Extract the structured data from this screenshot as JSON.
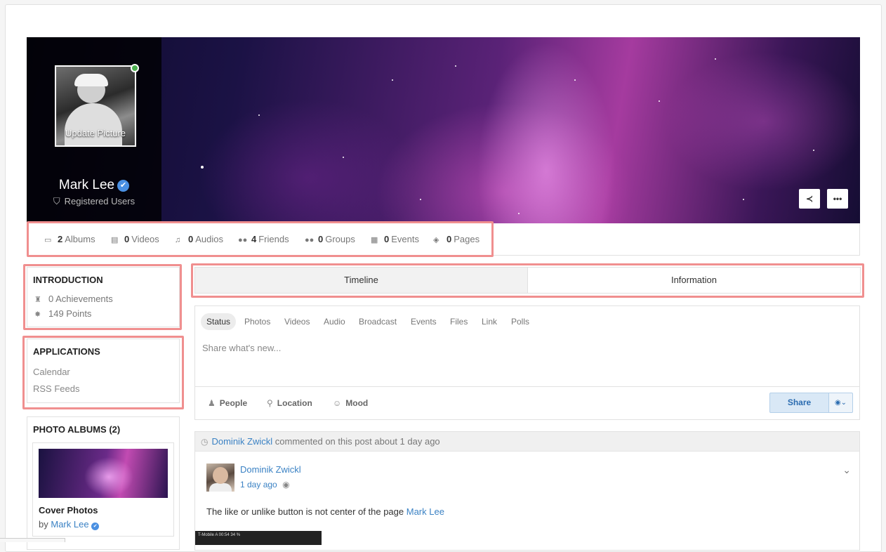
{
  "profile": {
    "name": "Mark Lee",
    "role": "Registered Users",
    "update_picture": "Update Picture",
    "verified_glyph": "✔"
  },
  "cover_actions": {
    "share_glyph": "≺",
    "more_glyph": "•••"
  },
  "stats": [
    {
      "count": "2",
      "label": "Albums",
      "icon": "image-icon"
    },
    {
      "count": "0",
      "label": "Videos",
      "icon": "film-icon"
    },
    {
      "count": "0",
      "label": "Audios",
      "icon": "music-icon"
    },
    {
      "count": "4",
      "label": "Friends",
      "icon": "users-icon"
    },
    {
      "count": "0",
      "label": "Groups",
      "icon": "group-icon"
    },
    {
      "count": "0",
      "label": "Events",
      "icon": "calendar-icon"
    },
    {
      "count": "0",
      "label": "Pages",
      "icon": "cube-icon"
    }
  ],
  "introduction": {
    "title": "INTRODUCTION",
    "achievements": "0 Achievements",
    "points": "149 Points"
  },
  "applications": {
    "title": "APPLICATIONS",
    "items": [
      "Calendar",
      "RSS Feeds"
    ]
  },
  "photo_albums": {
    "title": "PHOTO ALBUMS (2)",
    "album_name": "Cover Photos",
    "by_label": "by",
    "by_user": "Mark Lee"
  },
  "tabs": {
    "timeline": "Timeline",
    "information": "Information"
  },
  "composer": {
    "tabs": [
      "Status",
      "Photos",
      "Videos",
      "Audio",
      "Broadcast",
      "Events",
      "Files",
      "Link",
      "Polls"
    ],
    "placeholder": "Share what's new...",
    "people": "People",
    "location": "Location",
    "mood": "Mood",
    "share": "Share"
  },
  "post": {
    "activity_user": "Dominik Zwickl",
    "activity_text": "commented on this post about 1 day ago",
    "author": "Dominik Zwickl",
    "time": "1 day ago",
    "body": "The like or unlike button is not center of the page",
    "mention": "Mark Lee",
    "image_caption": "T-Mobile A   00:54   34 %"
  },
  "colors": {
    "accent": "#3b82c4",
    "highlight": "#f08f8f",
    "online": "#4caf50"
  }
}
